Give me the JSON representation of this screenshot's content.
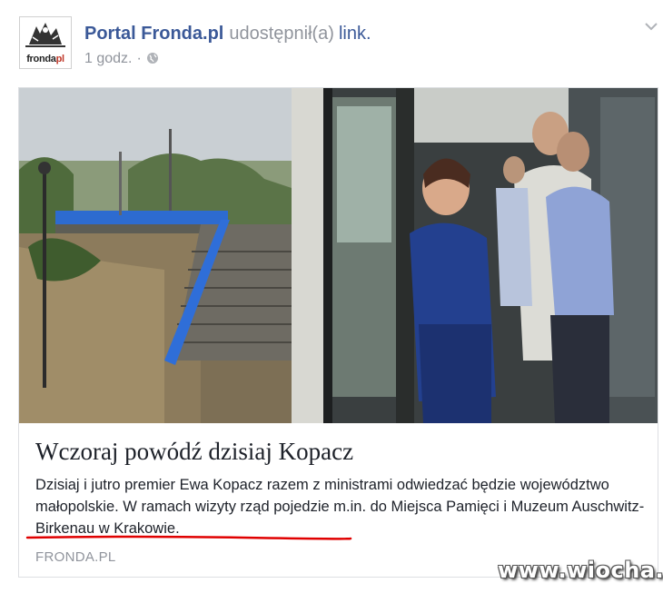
{
  "post": {
    "author": "Portal Fronda.pl",
    "action": "udostępnił(a)",
    "object": "link.",
    "time": "1 godz.",
    "separator": "·",
    "privacy_icon": "globe-icon",
    "options_icon": "chevron-down-icon"
  },
  "avatar": {
    "brand_main": "fronda",
    "brand_suffix": "pl"
  },
  "link_card": {
    "title": "Wczoraj powódź dzisiaj Kopacz",
    "description": "Dzisiaj i jutro premier Ewa Kopacz razem z ministrami odwiedzać będzie województwo małopolskie. W ramach wizyty rząd pojedzie m.in. do Miejsca Pamięci i Muzeum Auschwitz-Birkenau w Krakowie.",
    "source": "FRONDA.PL"
  },
  "annotation": {
    "underline_color": "#e00000"
  },
  "watermark": "www.wiocha.pl",
  "colors": {
    "link_blue": "#3b5998",
    "meta_gray": "#90949c",
    "border": "#dddfe2"
  }
}
